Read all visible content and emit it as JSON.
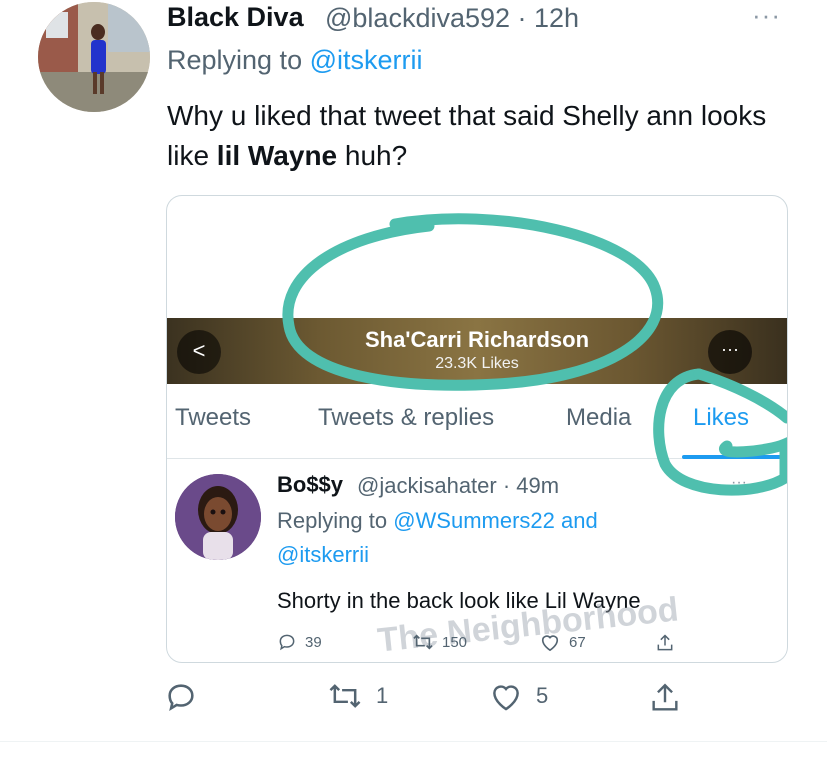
{
  "tweet": {
    "author_name": "Black Diva",
    "author_handle": "@blackdiva592 · 12h",
    "replying_prefix": "Replying to",
    "replying_mention": "@itskerrii",
    "text_part1": "Why u liked that tweet that said Shelly ann looks like",
    "text_bold": "lil Wayne",
    "text_part2": "huh?",
    "more_icon": "more-dots-icon"
  },
  "media": {
    "profile_name": "Sha'Carri Richardson",
    "profile_likes": "23.3K Likes",
    "back_icon": "<",
    "more_icon": "···",
    "tabs": [
      "Tweets",
      "Tweets & replies",
      "Media",
      "Likes"
    ],
    "active_tab": "Likes",
    "inner_tweet": {
      "name": "Bo$$y",
      "handle": "@jackisahater · 49m",
      "replying_prefix": "Replying to",
      "replying_mention": "@WSummers22 and",
      "mention2": "@itskerrii",
      "text": "Shorty in the back look like Lil Wayne",
      "replies": "39",
      "retweets": "150",
      "likes": "67",
      "more": "···"
    },
    "watermark": "The Neighborhood",
    "annotation_color": "#4fbfae"
  },
  "actions": {
    "reply_count": "",
    "retweet_count": "1",
    "like_count": "5"
  },
  "colors": {
    "accent": "#1d9bf0",
    "secondary_text": "#536471",
    "primary_text": "#0f1419"
  }
}
